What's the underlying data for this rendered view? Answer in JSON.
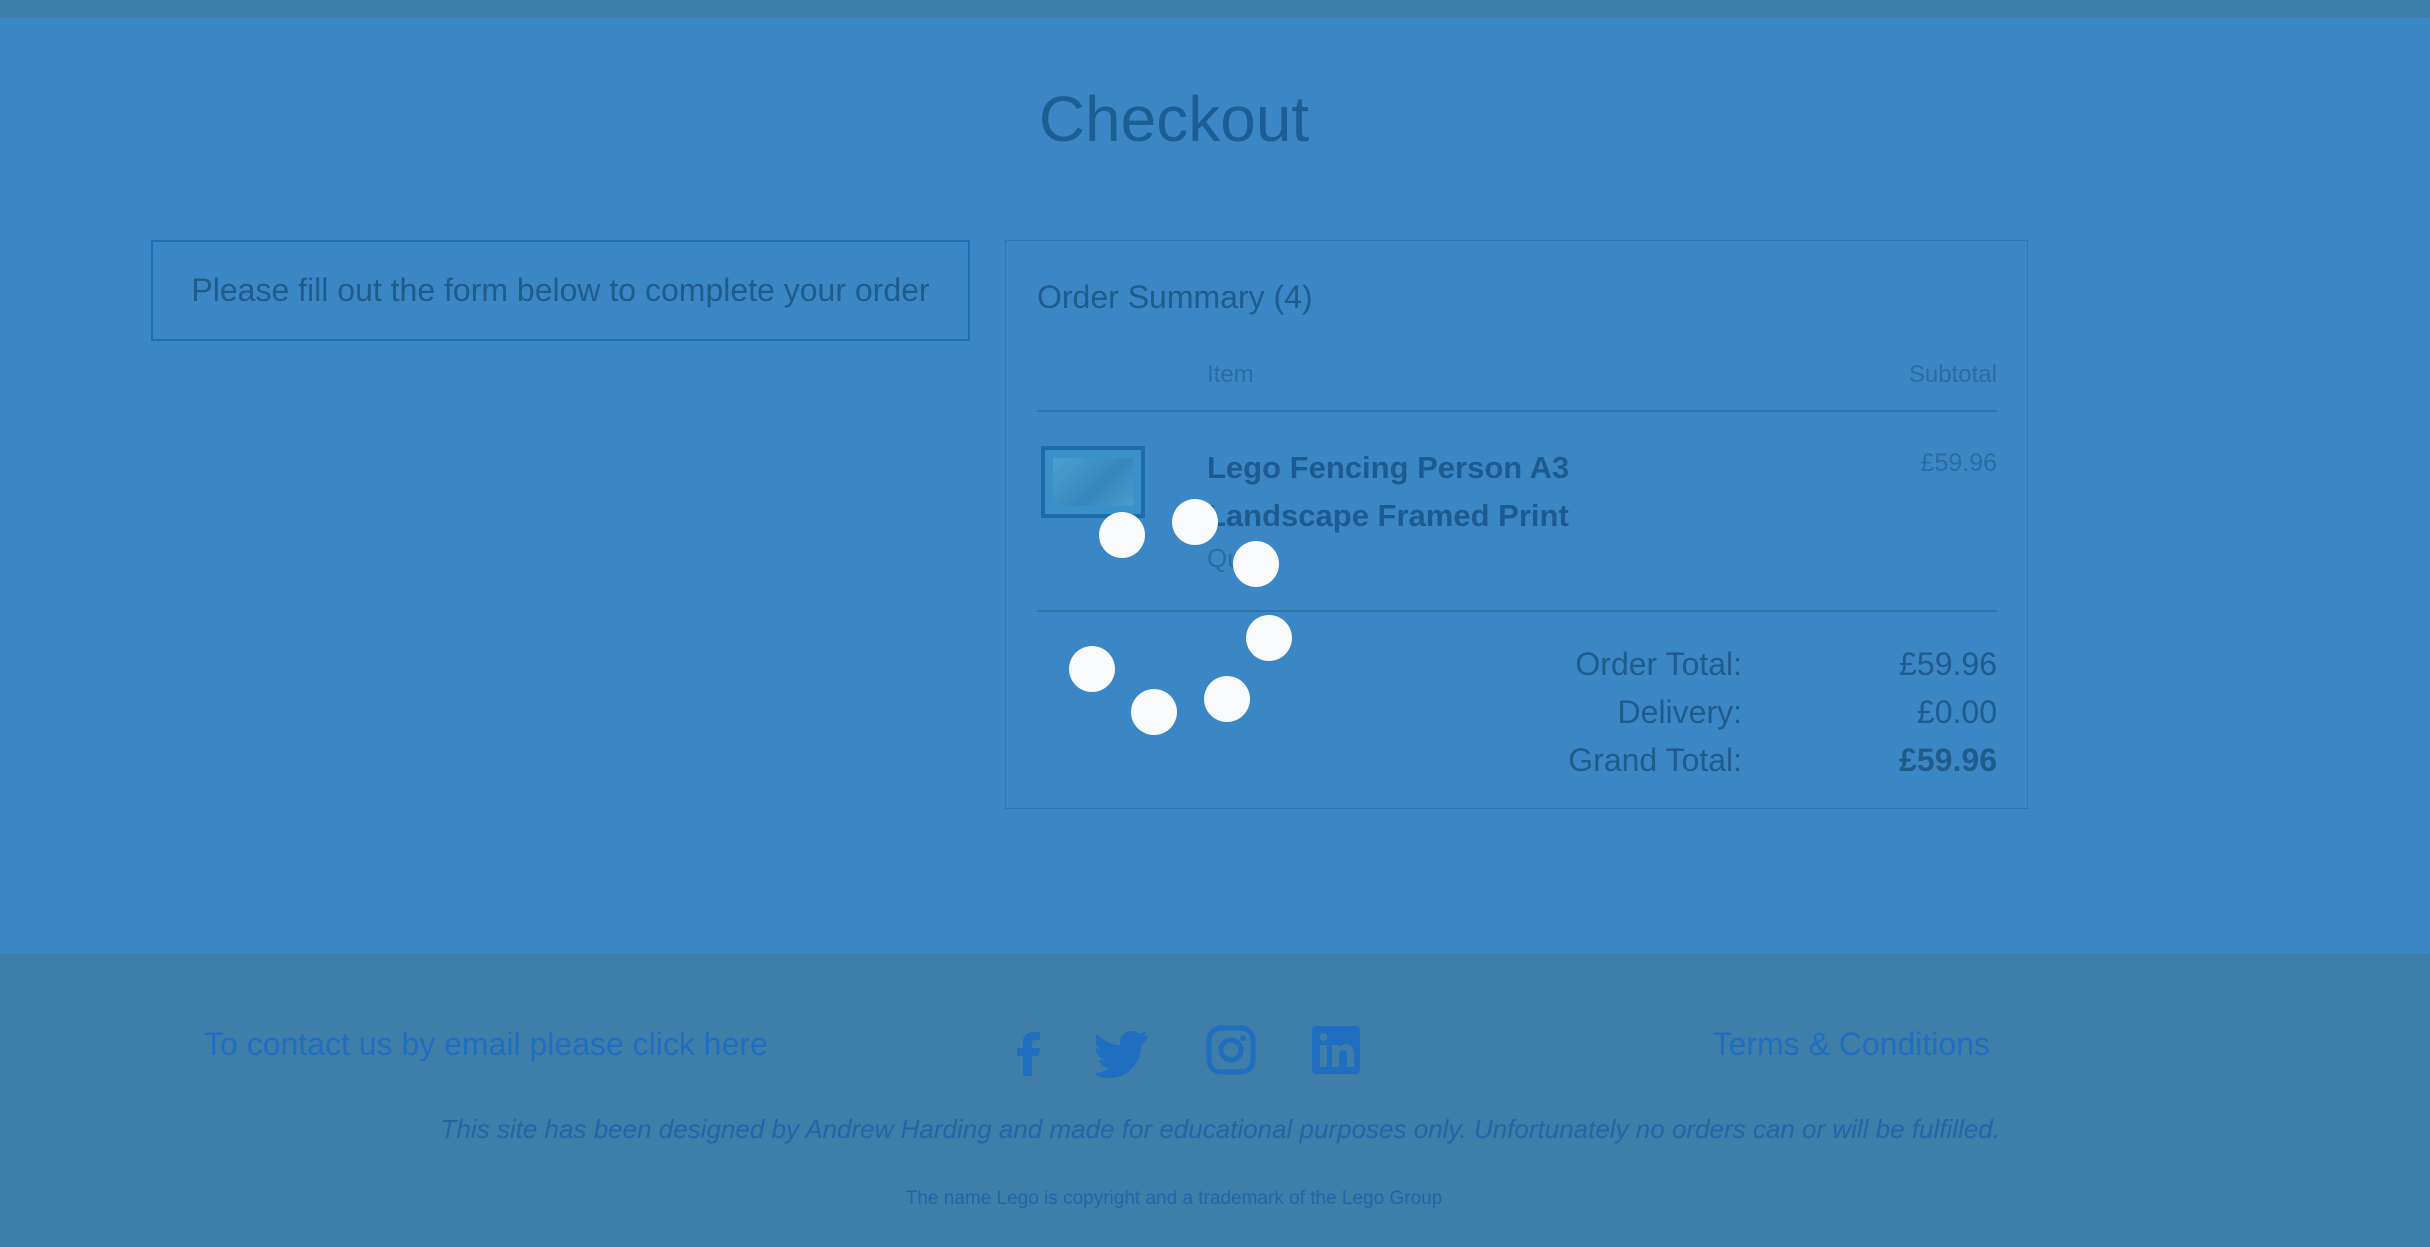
{
  "header": {
    "title": "Checkout"
  },
  "form": {
    "note": "Please fill out the form below to complete your order"
  },
  "summary": {
    "title": "Order Summary (4)",
    "col_item": "Item",
    "col_subtotal": "Subtotal",
    "item": {
      "name": "Lego Fencing Person A3 Landscape Framed Print",
      "qty_label": "Qu",
      "price": "£59.96"
    },
    "order_total_label": "Order Total:",
    "order_total_value": "£59.96",
    "delivery_label": "Delivery:",
    "delivery_value": "£0.00",
    "grand_total_label": "Grand Total:",
    "grand_total_value": "£59.96"
  },
  "footer": {
    "contact_link": "To contact us by email please click here",
    "terms_link": "Terms & Conditions",
    "disclaimer": "This site has been designed by Andrew Harding and made for educational purposes only. Unfortunately no orders can or will be fulfilled.",
    "copyright": "The name Lego is copyright and a trademark of the Lego Group",
    "social_icons": [
      "facebook-icon",
      "twitter-icon",
      "instagram-icon",
      "linkedin-icon"
    ]
  },
  "colors": {
    "background": "#3b87c5",
    "footer": "#3e7ea8",
    "link": "#1f6ec0",
    "spinner": "#fafbfd"
  }
}
